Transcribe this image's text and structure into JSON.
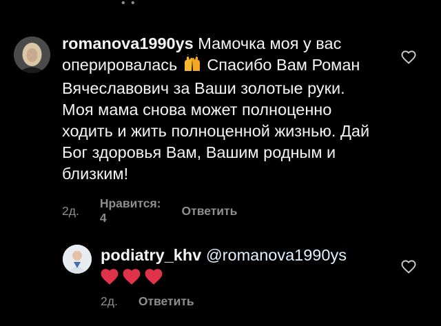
{
  "top_dots": "• •",
  "comment": {
    "username": "romanova1990ys",
    "text_part1": "Мамочка моя у вас оперировалась",
    "text_part2": "Спасибо Вам Роман Вячеславович за Ваши золотые руки. Моя мама снова может полноценно ходить и жить полноценной жизнью.  Дай Бог здоровья Вам, Вашим родным и близким!",
    "time": "2д.",
    "likes": "Нравится: 4",
    "reply": "Ответить"
  },
  "reply_comment": {
    "username": "podiatry_khv",
    "mention": "@romanova1990ys",
    "time": "2д.",
    "reply": "Ответить"
  },
  "colors": {
    "background": "#000000",
    "text": "#f5f5f5",
    "meta": "#8e8e8e",
    "heart_emoji": "#e0324a"
  },
  "icons": {
    "like": "heart-outline-icon",
    "emoji_hands": "raising-hands-emoji",
    "emoji_heart": "red-heart-emoji"
  }
}
